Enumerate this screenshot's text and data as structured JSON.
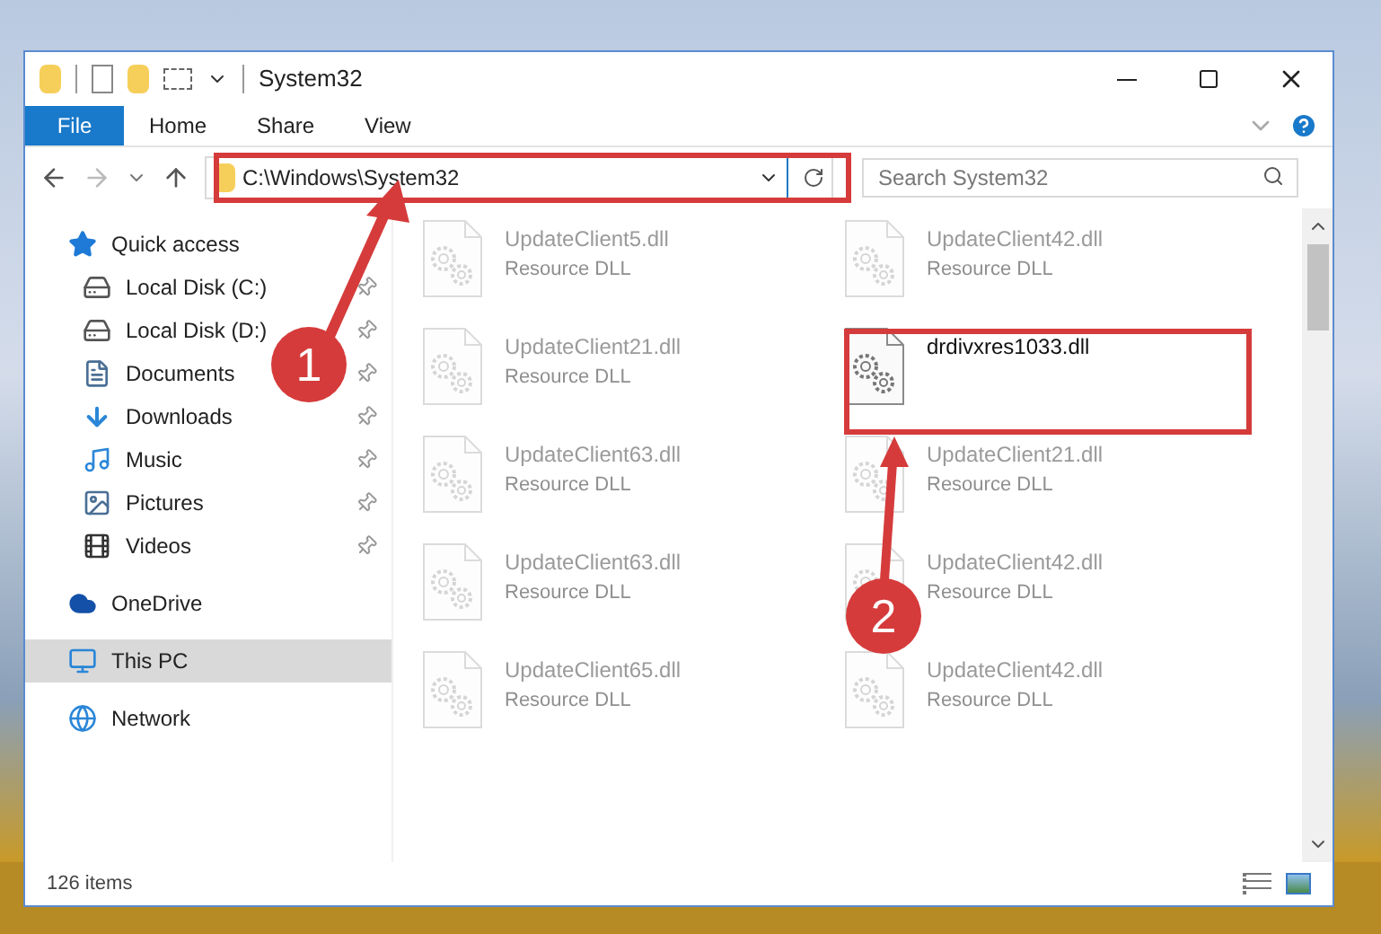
{
  "window": {
    "title": "System32"
  },
  "ribbon": {
    "tabs": [
      {
        "label": "File",
        "selected": true
      },
      {
        "label": "Home",
        "selected": false
      },
      {
        "label": "Share",
        "selected": false
      },
      {
        "label": "View",
        "selected": false
      }
    ]
  },
  "address_bar": {
    "path": "C:\\Windows\\System32"
  },
  "search": {
    "placeholder": "Search System32"
  },
  "navigation": [
    {
      "label": "Quick access",
      "kind": "star",
      "selected": false,
      "children": [
        {
          "label": "Local Disk (C:)",
          "kind": "drive",
          "pinned": true
        },
        {
          "label": "Local Disk (D:)",
          "kind": "drive",
          "pinned": true
        },
        {
          "label": "Documents",
          "kind": "document",
          "pinned": true
        },
        {
          "label": "Downloads",
          "kind": "download",
          "pinned": true
        },
        {
          "label": "Music",
          "kind": "music",
          "pinned": true
        },
        {
          "label": "Pictures",
          "kind": "picture",
          "pinned": true
        },
        {
          "label": "Videos",
          "kind": "video",
          "pinned": true
        }
      ]
    },
    {
      "label": "OneDrive",
      "kind": "cloud",
      "selected": false
    },
    {
      "label": "This PC",
      "kind": "computer",
      "selected": true
    },
    {
      "label": "Network",
      "kind": "network",
      "selected": false
    }
  ],
  "files": [
    {
      "name": "UpdateClient5.dll",
      "description": "Resource DLL",
      "faded": true
    },
    {
      "name": "UpdateClient42.dll",
      "description": "Resource DLL",
      "faded": true
    },
    {
      "name": "UpdateClient21.dll",
      "description": "Resource DLL",
      "faded": true
    },
    {
      "name": "drdivxres1033.dll",
      "faded": false
    },
    {
      "name": "UpdateClient63.dll",
      "description": "Resource DLL",
      "faded": true
    },
    {
      "name": "UpdateClient21.dll",
      "description": "Resource DLL",
      "faded": true
    },
    {
      "name": "UpdateClient63.dll",
      "description": "Resource DLL",
      "faded": true
    },
    {
      "name": "UpdateClient42.dll",
      "description": "Resource DLL",
      "faded": true
    },
    {
      "name": "UpdateClient65.dll",
      "description": "Resource DLL",
      "faded": true
    },
    {
      "name": "UpdateClient42.dll",
      "description": "Resource DLL",
      "faded": true
    }
  ],
  "status_bar": {
    "item_count": "126 items"
  },
  "annotations": {
    "markers": [
      {
        "label": "1"
      },
      {
        "label": "2"
      }
    ]
  }
}
